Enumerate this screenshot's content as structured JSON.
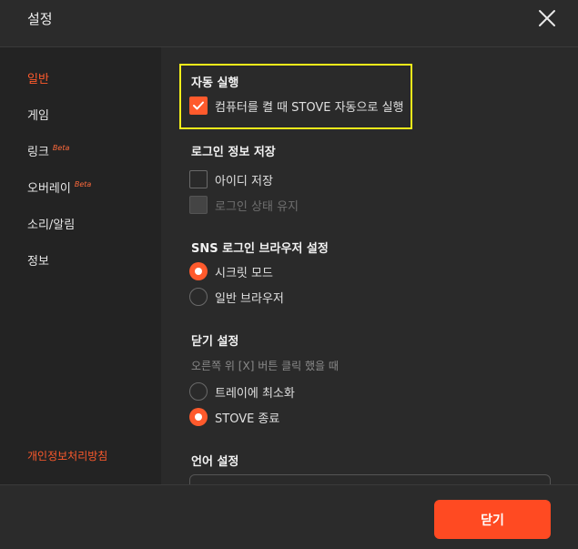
{
  "header": {
    "title": "설정",
    "close_icon": "close-icon"
  },
  "sidebar": {
    "items": [
      {
        "label": "일반",
        "active": true
      },
      {
        "label": "게임"
      },
      {
        "label": "링크",
        "badge": "Beta"
      },
      {
        "label": "오버레이",
        "badge": "Beta"
      },
      {
        "label": "소리/알림"
      },
      {
        "label": "정보"
      }
    ],
    "privacy_link": "개인정보처리방침"
  },
  "autorun": {
    "title": "자동 실행",
    "option_label": "컴퓨터를 켤 때 STOVE 자동으로 실행",
    "checked": true
  },
  "login_info": {
    "title": "로그인 정보 저장",
    "options": [
      {
        "label": "아이디 저장",
        "checked": false,
        "disabled": false
      },
      {
        "label": "로그인 상태 유지",
        "checked": false,
        "disabled": true
      }
    ]
  },
  "sns_browser": {
    "title": "SNS 로그인 브라우저 설정",
    "options": [
      {
        "label": "시크릿 모드",
        "selected": true
      },
      {
        "label": "일반 브라우저",
        "selected": false
      }
    ]
  },
  "close_setting": {
    "title": "닫기 설정",
    "description": "오른쪽 위 [X] 버튼 클릭 했을 때",
    "options": [
      {
        "label": "트레이에 최소화",
        "selected": false
      },
      {
        "label": "STOVE 종료",
        "selected": true
      }
    ]
  },
  "language": {
    "title": "언어 설정"
  },
  "footer": {
    "close_button": "닫기"
  },
  "colors": {
    "accent": "#ff5a2c",
    "highlight": "#f4ef1a"
  }
}
